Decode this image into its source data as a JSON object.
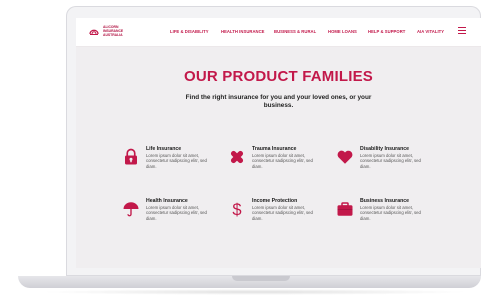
{
  "brand": {
    "logo_text": "ALICORN INSURANCE AUSTRALIA",
    "accent": "#c2184a"
  },
  "nav": {
    "items": [
      {
        "label": "LIFE & DISABILITY"
      },
      {
        "label": "HEALTH INSURANCE"
      },
      {
        "label": "BUSINESS & RURAL"
      },
      {
        "label": "HOME LOANS"
      },
      {
        "label": "HELP & SUPPORT"
      },
      {
        "label": "AIA VITALITY"
      }
    ],
    "menu_icon": "hamburger-icon"
  },
  "main": {
    "title": "OUR PRODUCT FAMILIES",
    "subtitle": "Find the right insurance for you and your loved ones, or your business."
  },
  "products": [
    {
      "name": "Life Insurance",
      "desc": "Lorem ipsum dolor sit amet, consectetur sadipscing elitr, sed diam.",
      "icon": "lock-icon"
    },
    {
      "name": "Trauma Insurance",
      "desc": "Lorem ipsum dolor sit amet, consectetur sadipscing elitr, sed diam.",
      "icon": "bandage-icon"
    },
    {
      "name": "Disability Insurance",
      "desc": "Lorem ipsum dolor sit amet, consectetur sadipscing elitr, sed diam.",
      "icon": "heart-icon"
    },
    {
      "name": "Health Insurance",
      "desc": "Lorem ipsum dolor sit amet, consectetur sadipscing elitr, sed diam.",
      "icon": "umbrella-icon"
    },
    {
      "name": "Income Protection",
      "desc": "Lorem ipsum dolor sit amet, consectetur sadipscing elitr, sed diam.",
      "icon": "dollar-icon"
    },
    {
      "name": "Business Insurance",
      "desc": "Lorem ipsum dolor sit amet, consectetur sadipscing elitr, sed diam.",
      "icon": "briefcase-icon"
    }
  ]
}
